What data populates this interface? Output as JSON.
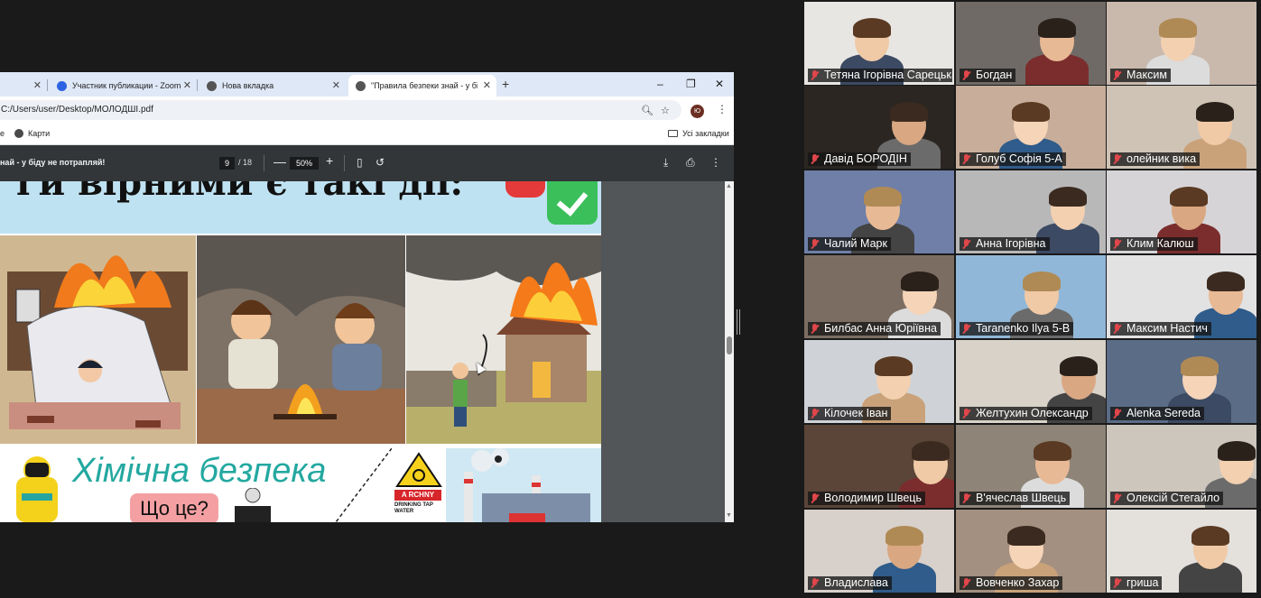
{
  "browser": {
    "tabs": [
      {
        "label": "",
        "active": false
      },
      {
        "label": "Участник публикации - Zoom",
        "active": false,
        "icon": "zoom-icon"
      },
      {
        "label": "Нова вкладка",
        "active": false,
        "icon": "globe-icon"
      },
      {
        "label": "\"Правила безпеки знай - у біді",
        "active": true,
        "icon": "globe-icon"
      }
    ],
    "new_tab_glyph": "+",
    "window_controls": {
      "minimize": "–",
      "restore": "❐",
      "close": "✕"
    },
    "url": "C:/Users/user/Desktop/МОЛОДШІ.pdf",
    "profile_initials": "Ю",
    "bookmarks": {
      "left_fragment": "е",
      "maps": "Карти",
      "all": "Усі закладки"
    }
  },
  "pdf": {
    "title": "най - у біду не потрапляй!",
    "current_page": "9",
    "total_pages": "/ 18",
    "zoom": "50%",
    "minus": "—",
    "plus": "+",
    "page": {
      "banner_title": "ги вірними є такі дії:",
      "chemistry_title": "Хімічна безпека",
      "chemistry_question": "Що це?",
      "sign_label": "A RCHNY",
      "sign_text": "DRINKING TAP WATER"
    }
  },
  "participants": [
    {
      "name": "Тетяна Ігорівна Сарецька",
      "bg": "#e8e6e2"
    },
    {
      "name": "Богдан",
      "bg": "#6f6a66"
    },
    {
      "name": "Максим",
      "bg": "#c9b9ad"
    },
    {
      "name": "Давід БОРОДІН",
      "bg": "#2b2622"
    },
    {
      "name": "Голуб Софія 5-А",
      "bg": "#c8ae9a"
    },
    {
      "name": "олейник вика",
      "bg": "#cfc3b6"
    },
    {
      "name": "Чалий Марк",
      "bg": "#6f7fa8"
    },
    {
      "name": "Анна Ігорівна",
      "bg": "#b8b8b8"
    },
    {
      "name": "Клим Калюш",
      "bg": "#d6d4d6"
    },
    {
      "name": "Билбас Анна Юріївна",
      "bg": "#7c6d62"
    },
    {
      "name": "Taranenko Ilya 5-B",
      "bg": "#90b7d8"
    },
    {
      "name": "Максим  Настич",
      "bg": "#e2e2e2"
    },
    {
      "name": "Кілочек Іван",
      "bg": "#cfd3d8"
    },
    {
      "name": "Желтухин Олександр",
      "bg": "#d8d2c8"
    },
    {
      "name": "Alenka Sereda",
      "bg": "#5b6c86"
    },
    {
      "name": "Володимир Швець",
      "bg": "#5a4538"
    },
    {
      "name": "В'ячеслав Швець",
      "bg": "#8e8478"
    },
    {
      "name": "Олексій Стегайло",
      "bg": "#cdc6bd"
    },
    {
      "name": "Владислава",
      "bg": "#d8d0ca"
    },
    {
      "name": "Вовченко Захар",
      "bg": "#a49080"
    },
    {
      "name": "гриша",
      "bg": "#e4e0dc"
    }
  ]
}
